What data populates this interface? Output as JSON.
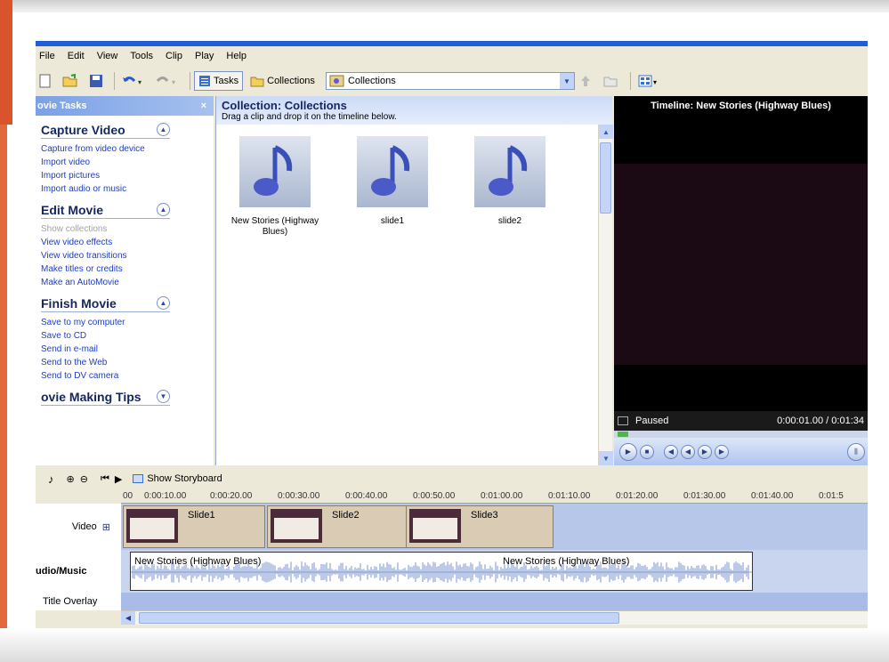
{
  "menu": [
    "File",
    "Edit",
    "View",
    "Tools",
    "Clip",
    "Play",
    "Help"
  ],
  "toolbar": {
    "tasks_label": "Tasks",
    "collections_label": "Collections",
    "combo_value": "Collections"
  },
  "taskpane": {
    "header": "ovie Tasks",
    "close": "×",
    "sections": [
      {
        "title": "Capture Video",
        "links": [
          "Capture from video device",
          "Import video",
          "Import pictures",
          "Import audio or music"
        ]
      },
      {
        "title": "Edit Movie",
        "links": [
          "Show collections",
          "View video effects",
          "View video transitions",
          "Make titles or credits",
          "Make an AutoMovie"
        ]
      },
      {
        "title": "Finish Movie",
        "links": [
          "Save to my computer",
          "Save to CD",
          "Send in e-mail",
          "Send to the Web",
          "Send to DV camera"
        ]
      },
      {
        "title": "ovie Making Tips",
        "links": []
      }
    ]
  },
  "collection": {
    "title": "Collection: Collections",
    "subtitle": "Drag a clip and drop it on the timeline below.",
    "clips": [
      "New Stories (Highway Blues)",
      "slide1",
      "slide2"
    ]
  },
  "monitor": {
    "title": "Timeline: New Stories (Highway Blues)",
    "status": "Paused",
    "time": "0:00:01.00 / 0:01:34"
  },
  "timeline": {
    "show_storyboard": "Show Storyboard",
    "ruler": [
      "00",
      "0:00:10.00",
      "0:00:20.00",
      "0:00:30.00",
      "0:00:40.00",
      "0:00:50.00",
      "0:01:00.00",
      "0:01:10.00",
      "0:01:20.00",
      "0:01:30.00",
      "0:01:40.00",
      "0:01:5"
    ],
    "tracks": {
      "video": "Video",
      "audio": "udio/Music",
      "title": "Title Overlay"
    },
    "video_clips": [
      "Slide1",
      "Slide2",
      "Slide3"
    ],
    "audio_labels": [
      "New Stories (Highway Blues)",
      "New Stories (Highway Blues)"
    ],
    "expand": "⊞"
  },
  "colors": {
    "accent": "#1f5fd6",
    "task_link": "#1c3ec4"
  }
}
